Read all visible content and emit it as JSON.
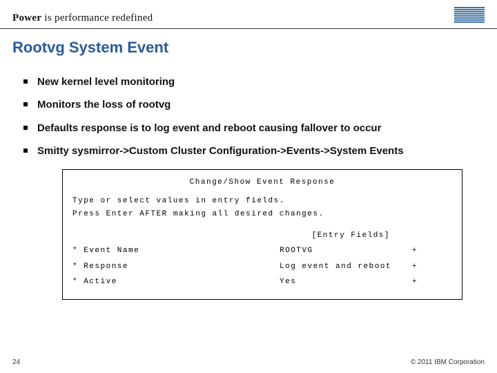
{
  "header": {
    "tagline_bold": "Power",
    "tagline_rest": " is performance redefined",
    "logo": "IBM"
  },
  "title": "Rootvg System Event",
  "bullets": [
    "New kernel level monitoring",
    "Monitors the loss of rootvg",
    "Defaults response is to log event and reboot causing fallover to occur",
    "Smitty sysmirror->Custom Cluster Configuration->Events->System Events"
  ],
  "panel": {
    "title": "Change/Show Event Response",
    "intro1": "Type or select values in entry fields.",
    "intro2": "Press Enter AFTER making all desired changes.",
    "entry_header": "[Entry Fields]",
    "rows": [
      {
        "label": "* Event Name",
        "value": "ROOTVG",
        "plus": "+"
      },
      {
        "label": "* Response",
        "value": "Log event and reboot",
        "plus": "+"
      },
      {
        "label": "* Active",
        "value": "Yes",
        "plus": "+"
      }
    ]
  },
  "footer": {
    "page": "24",
    "copyright": "© 2011 IBM Corporation"
  }
}
